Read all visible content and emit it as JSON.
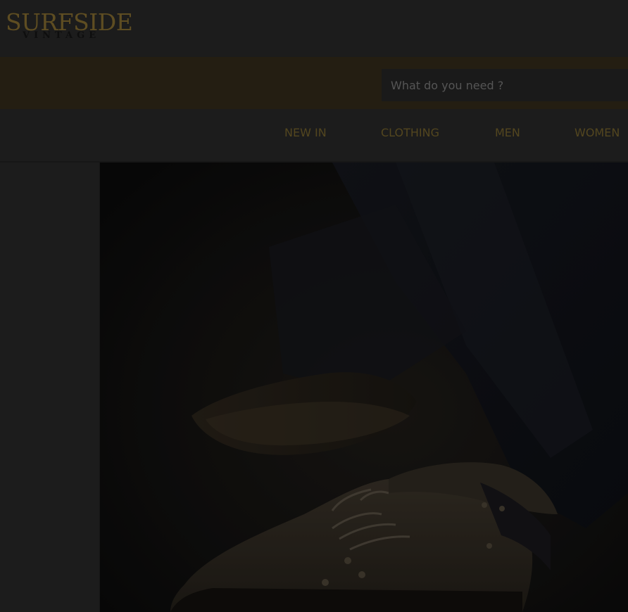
{
  "brand": {
    "name": "SURFSIDE",
    "tagline": "VINTAGE"
  },
  "search": {
    "placeholder": "What do you need ?",
    "value": ""
  },
  "nav": {
    "items": [
      {
        "label": "NEW IN"
      },
      {
        "label": "CLOTHING"
      },
      {
        "label": "MEN"
      },
      {
        "label": "WOMEN"
      }
    ]
  },
  "colors": {
    "brand_gold": "#5e4d22",
    "nav_text": "#53461f",
    "search_band": "#241e12",
    "overlay": "#1c1c1c"
  },
  "hero": {
    "icon": "boots-photo"
  }
}
